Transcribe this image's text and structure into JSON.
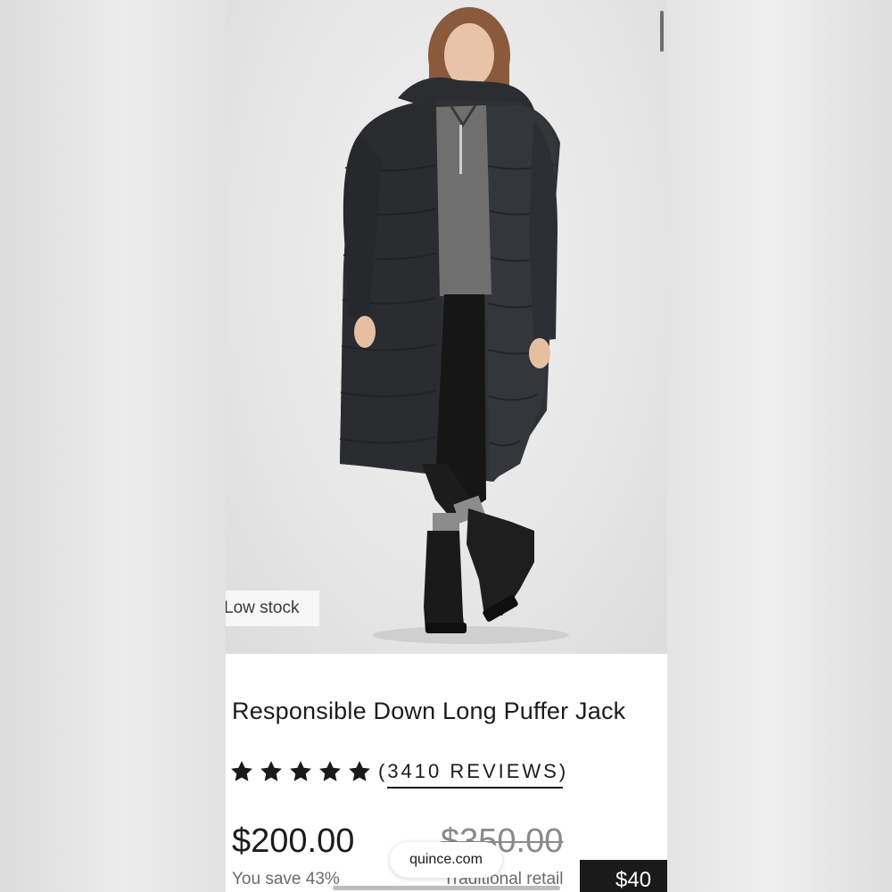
{
  "product": {
    "stock_badge": "Low stock",
    "title": "Responsible Down Long Puffer Jack",
    "rating": 5,
    "reviews_label": "(3410 REVIEWS)",
    "price_current": "$200.00",
    "price_traditional": "$350.00",
    "savings_text": "You save 43%",
    "retail_label": "Traditional retail"
  },
  "browser": {
    "url": "quince.com"
  },
  "cta": {
    "label": "$40"
  },
  "colors": {
    "coat": "#2b2d31",
    "sweater": "#707070",
    "background": "#e6e6e6",
    "button": "#1a1a1a"
  },
  "icons": {
    "star": "star-icon"
  }
}
